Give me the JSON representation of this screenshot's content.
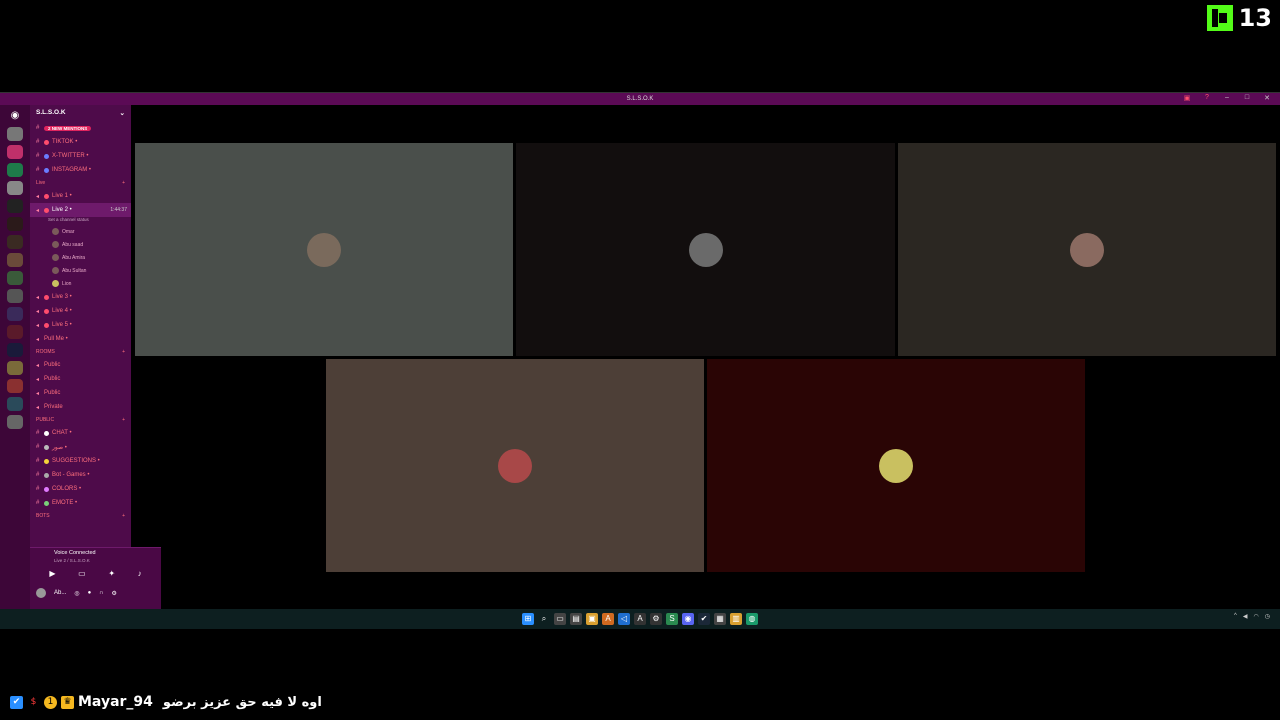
{
  "overlay": {
    "viewer_count": "13"
  },
  "window": {
    "title": "S.L.S.O.K"
  },
  "guild": {
    "name": "S.L.S.O.K"
  },
  "channels": [
    {
      "label": "2 NEW MENTIONS",
      "type": "mention"
    },
    {
      "label": "TIKTOK •",
      "color": "#ff4d6d"
    },
    {
      "label": "X-TWITTER •",
      "color": "#6a7cff"
    },
    {
      "label": "INSTAGRAM •",
      "color": "#6a7cff"
    }
  ],
  "live_category": "Live",
  "live_channels": [
    {
      "label": "Live 1 •"
    },
    {
      "label": "Live 2 •",
      "active": true,
      "time": "1:44:37"
    }
  ],
  "voice_status": "Set a channel status",
  "voice_users": [
    "Omar",
    "Abu saad",
    "Abu Amira",
    "Abu Sultan",
    "Lion"
  ],
  "more_live": [
    "Live 3 •",
    "Live 4 •",
    "Live 5 •",
    "Pull Me •"
  ],
  "rooms_category": "ROOMS",
  "rooms": [
    "Public",
    "Public",
    "Public",
    "Private"
  ],
  "public_category": "PUBLIC",
  "public_channels": [
    "CHAT •",
    "صور •",
    "SUGGESTIONS •",
    "Bot - Games •",
    "COLORS •",
    "EMOTE •"
  ],
  "bots_category": "BOTS",
  "voice_panel": {
    "title": "Voice Connected",
    "sub": "Live 2 / S.L.S.O.K"
  },
  "user": {
    "name": "Ab..."
  },
  "tiles": [
    {
      "color": "#4a4f4b",
      "avatar": "#7a6a5c"
    },
    {
      "color": "#120e0e",
      "avatar": "#6a6a6a"
    },
    {
      "color": "#2b2722",
      "avatar": "#8a6a60"
    },
    {
      "color": "#4d3f37",
      "avatar": "#a84848"
    },
    {
      "color": "#2a0505",
      "avatar": "#c9c060"
    }
  ],
  "chat": {
    "username": "Mayar_94",
    "message": "اوه لا فيه حق عزيز برضو"
  }
}
